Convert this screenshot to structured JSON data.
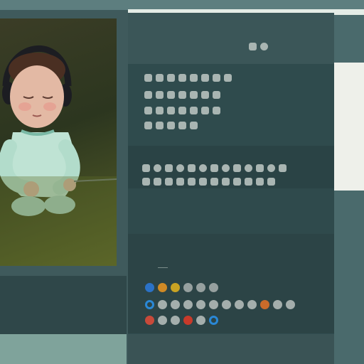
{
  "colors": {
    "background": "#3f5a5c",
    "panel": "#324d50",
    "text": "#cfd7d4",
    "glyph": "#a9b5b2",
    "light_panel": "#eef0ea"
  },
  "video": {
    "subject": "baby-wearing-headphones-illustration"
  },
  "header": {
    "title": "",
    "subtitle": ""
  },
  "section_2": {
    "title": ""
  },
  "section_3": {
    "label": ""
  },
  "section_4": {
    "title": ""
  },
  "icon_rows": {
    "row1": [
      {
        "name": "blue-circle-icon",
        "color": "#2b72c7"
      },
      {
        "name": "orange-circle-icon",
        "color": "#d08a25"
      },
      {
        "name": "yellow-circle-icon",
        "color": "#c9a323"
      },
      {
        "name": "gray-circle-icon",
        "color": "#96a09f"
      },
      {
        "name": "gray-circle-icon",
        "color": "#96a09f"
      },
      {
        "name": "gray-circle-icon",
        "color": "#96a09f"
      }
    ],
    "row2": [
      {
        "name": "blue-ring-icon",
        "color": "#2a88d6"
      },
      {
        "name": "gray-icon",
        "color": "#a4aeac"
      },
      {
        "name": "gray-icon",
        "color": "#a4aeac"
      },
      {
        "name": "gray-icon",
        "color": "#a4aeac"
      },
      {
        "name": "gray-icon",
        "color": "#a4aeac"
      },
      {
        "name": "gray-icon",
        "color": "#a4aeac"
      },
      {
        "name": "gray-icon",
        "color": "#a4aeac"
      },
      {
        "name": "gray-icon",
        "color": "#a4aeac"
      },
      {
        "name": "gray-icon",
        "color": "#a4aeac"
      },
      {
        "name": "orange-icon",
        "color": "#c96b2a"
      },
      {
        "name": "gray-icon",
        "color": "#a4aeac"
      },
      {
        "name": "gray-icon",
        "color": "#a4aeac"
      }
    ],
    "row3": [
      {
        "name": "red-circle-icon",
        "color": "#c84a3a"
      },
      {
        "name": "gray-circle-icon",
        "color": "#a4aeac"
      },
      {
        "name": "gray-circle-icon",
        "color": "#a4aeac"
      },
      {
        "name": "red-circle-icon",
        "color": "#c83a2a"
      },
      {
        "name": "gray-circle-icon",
        "color": "#a4aeac"
      },
      {
        "name": "blue-ring-icon",
        "color": "#2a88d6"
      }
    ]
  }
}
